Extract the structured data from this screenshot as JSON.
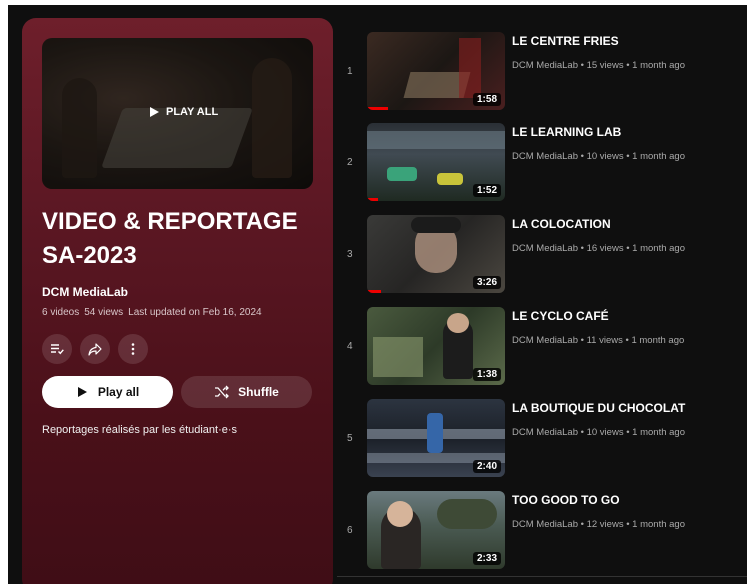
{
  "playlist": {
    "title_line1": "VIDEO & REPORTAGE",
    "title_line2": "SA-2023",
    "channel": "DCM MediaLab",
    "video_count": "6 videos",
    "views": "54 views",
    "updated": "Last updated on Feb 16, 2024",
    "hero_overlay_label": "PLAY ALL",
    "play_all_label": "Play all",
    "shuffle_label": "Shuffle",
    "description": "Reportages réalisés par les étudiant·e·s",
    "accent_color": "#5b1723"
  },
  "videos": [
    {
      "index": "1",
      "title": "LE CENTRE FRIES",
      "meta": "DCM MediaLab • 15 views • 1 month ago",
      "duration": "1:58",
      "watched_fraction": 0.15
    },
    {
      "index": "2",
      "title": "LE LEARNING LAB",
      "meta": "DCM MediaLab • 10 views • 1 month ago",
      "duration": "1:52",
      "watched_fraction": 0.08
    },
    {
      "index": "3",
      "title": "LA COLOCATION",
      "meta": "DCM MediaLab • 16 views • 1 month ago",
      "duration": "3:26",
      "watched_fraction": 0.1
    },
    {
      "index": "4",
      "title": "LE CYCLO CAFÉ",
      "meta": "DCM MediaLab • 11 views • 1 month ago",
      "duration": "1:38",
      "watched_fraction": 0
    },
    {
      "index": "5",
      "title": "LA BOUTIQUE DU CHOCOLAT",
      "meta": "DCM MediaLab • 10 views • 1 month ago",
      "duration": "2:40",
      "watched_fraction": 0
    },
    {
      "index": "6",
      "title": "TOO GOOD TO GO",
      "meta": "DCM MediaLab • 12 views • 1 month ago",
      "duration": "2:33",
      "watched_fraction": 0
    }
  ]
}
